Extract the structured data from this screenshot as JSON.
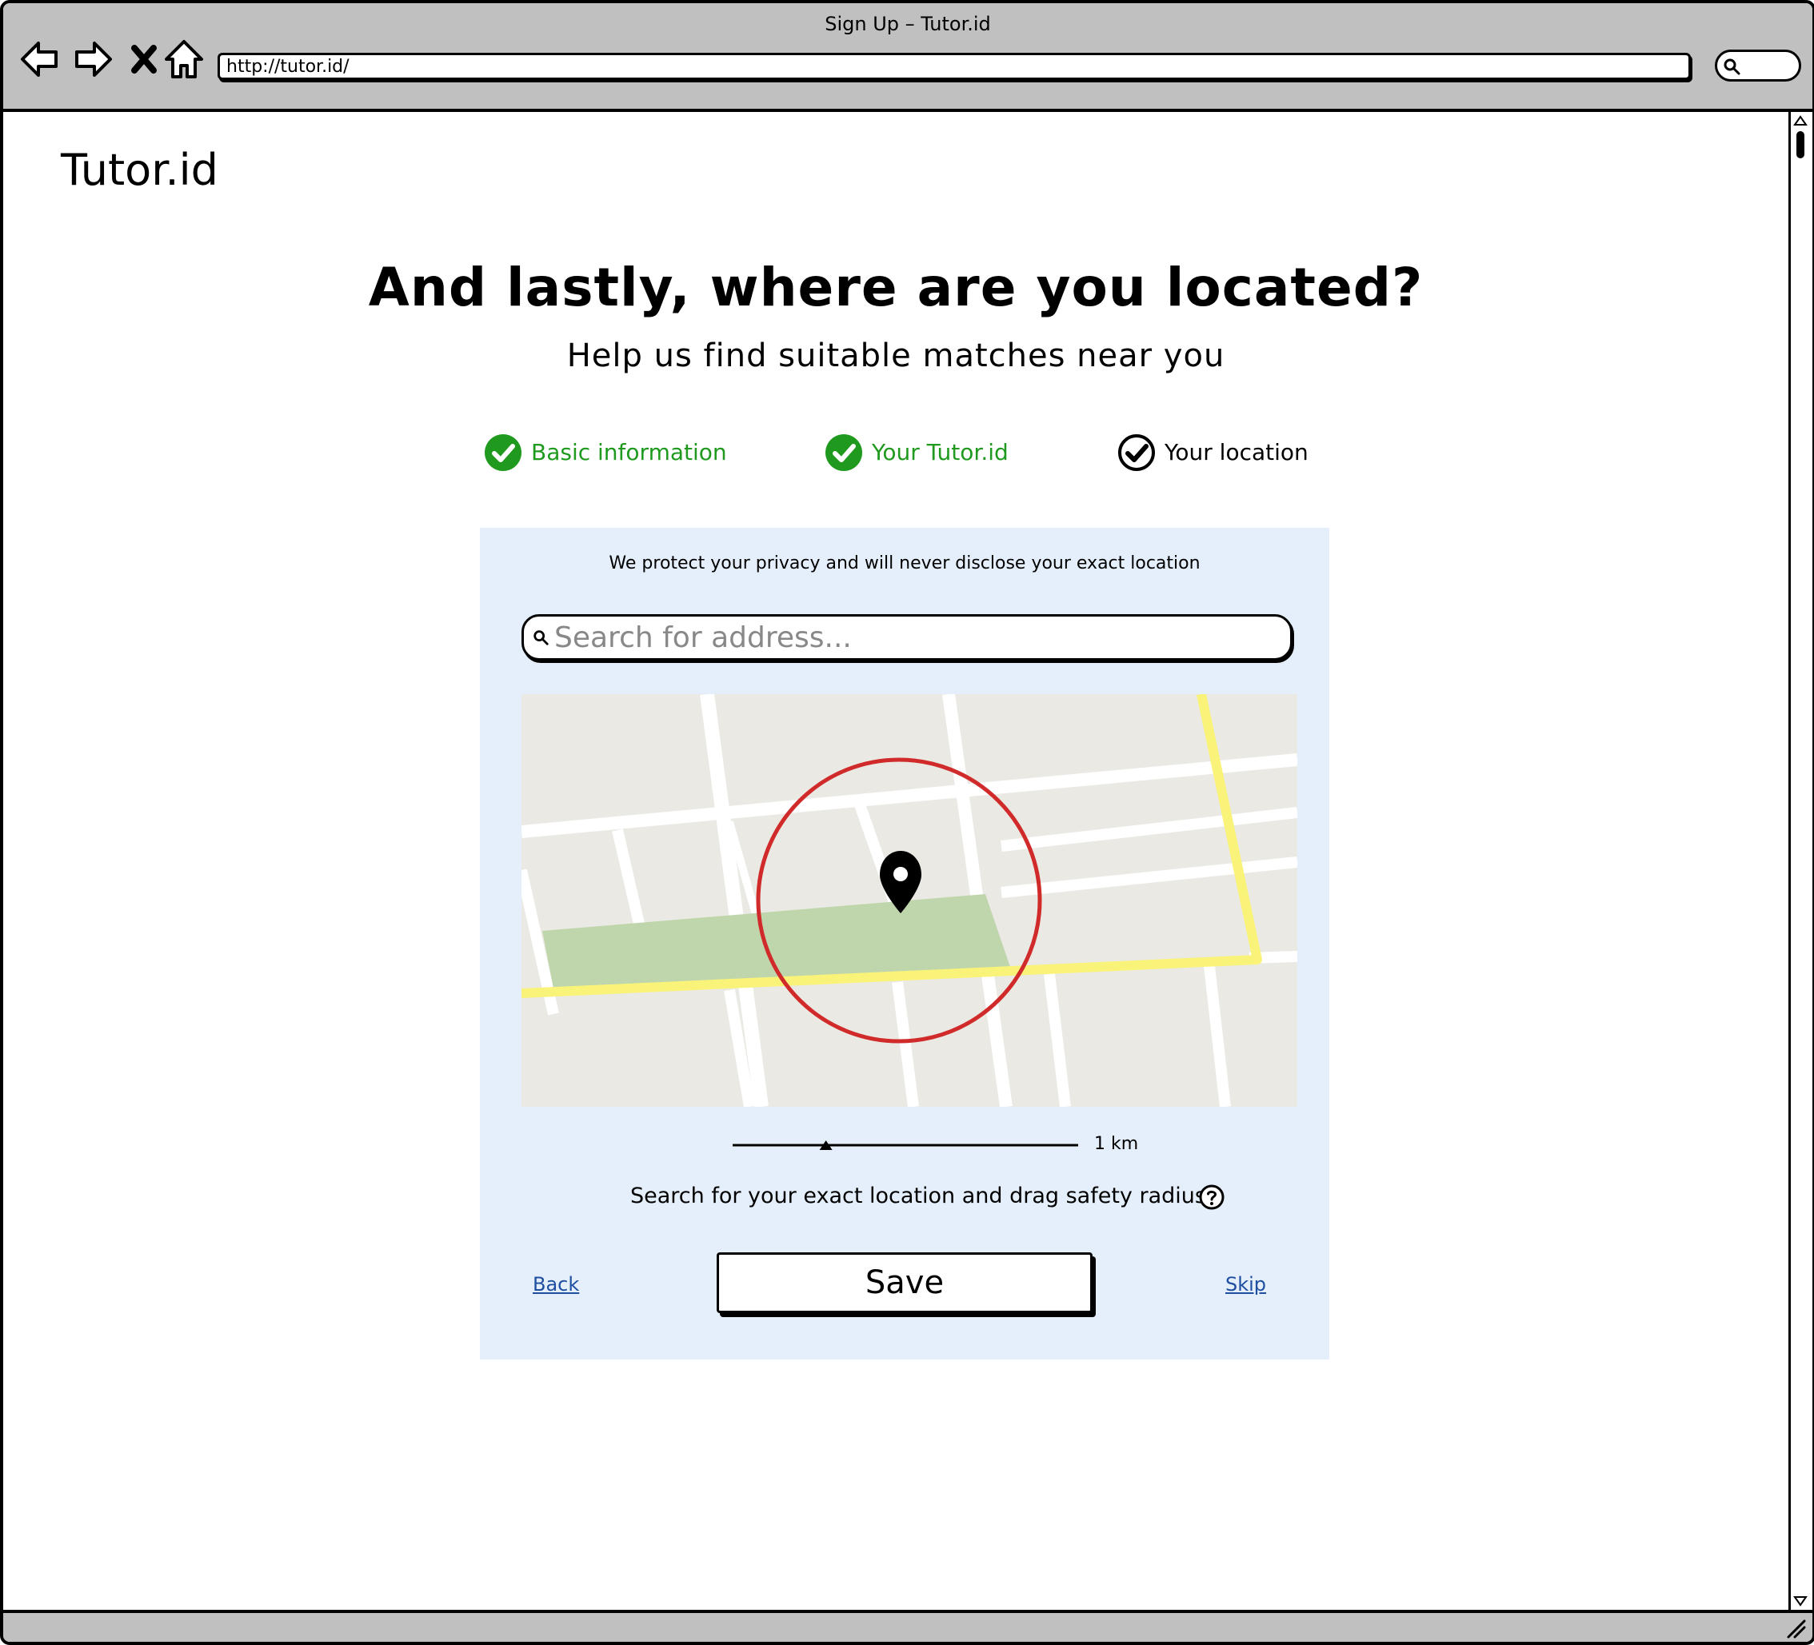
{
  "window": {
    "title": "Sign Up – Tutor.id"
  },
  "browser": {
    "url": "http://tutor.id/",
    "nav_icons": [
      "back-arrow-icon",
      "forward-arrow-icon",
      "stop-icon",
      "home-icon"
    ]
  },
  "brand": {
    "logo": "Tutor.id"
  },
  "page": {
    "title": "And lastly, where are you located?",
    "subtitle": "Help us find suitable matches near you"
  },
  "steps": [
    {
      "label": "Basic information",
      "state": "done"
    },
    {
      "label": "Your Tutor.id",
      "state": "done"
    },
    {
      "label": "Your location",
      "state": "current"
    }
  ],
  "location_card": {
    "privacy_note": "We protect your privacy and will never disclose your exact location",
    "search": {
      "placeholder": "Search for address...",
      "value": ""
    },
    "map": {
      "marker_icon": "map-pin-icon"
    },
    "radius": {
      "label": "1 km",
      "level_fraction": 0.27
    },
    "instruction": "Search for your exact location and drag safety radius",
    "back_label": "Back",
    "save_label": "Save",
    "skip_label": "Skip"
  },
  "colors": {
    "step_done": "#1f9a1f",
    "card_bg": "#e5effb",
    "link": "#1d4ea0",
    "radius_circle": "#d02a2a",
    "chrome": "#c0c0c0"
  }
}
